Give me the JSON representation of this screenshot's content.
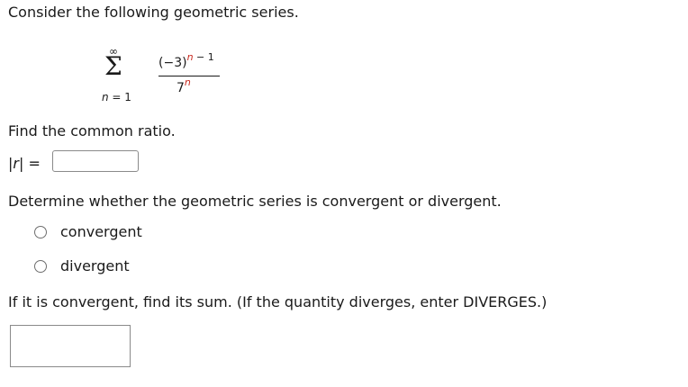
{
  "question": {
    "intro": "Consider the following geometric series.",
    "series": {
      "upper_limit": "∞",
      "lower_limit_var": "n",
      "lower_limit_rest": " = 1",
      "sigma": "Σ",
      "numerator_base": "(−3)",
      "numerator_exp_var": "n",
      "numerator_exp_rest": " − 1",
      "denominator_base": "7",
      "denominator_exp": "n"
    },
    "find_ratio": "Find the common ratio.",
    "ratio_label_open": "|",
    "ratio_label_var": "r",
    "ratio_label_close": "|  =",
    "ratio_input_value": "",
    "determine": "Determine whether the geometric series is convergent or divergent.",
    "options": [
      {
        "label": "convergent",
        "selected": false
      },
      {
        "label": "divergent",
        "selected": false
      }
    ],
    "sum_prompt": "If it is convergent, find its sum. (If the quantity diverges, enter DIVERGES.)",
    "sum_input_value": ""
  },
  "colors": {
    "text": "#1a1a1a",
    "highlight": "#c8281e",
    "input_border": "#8a8a8a"
  }
}
